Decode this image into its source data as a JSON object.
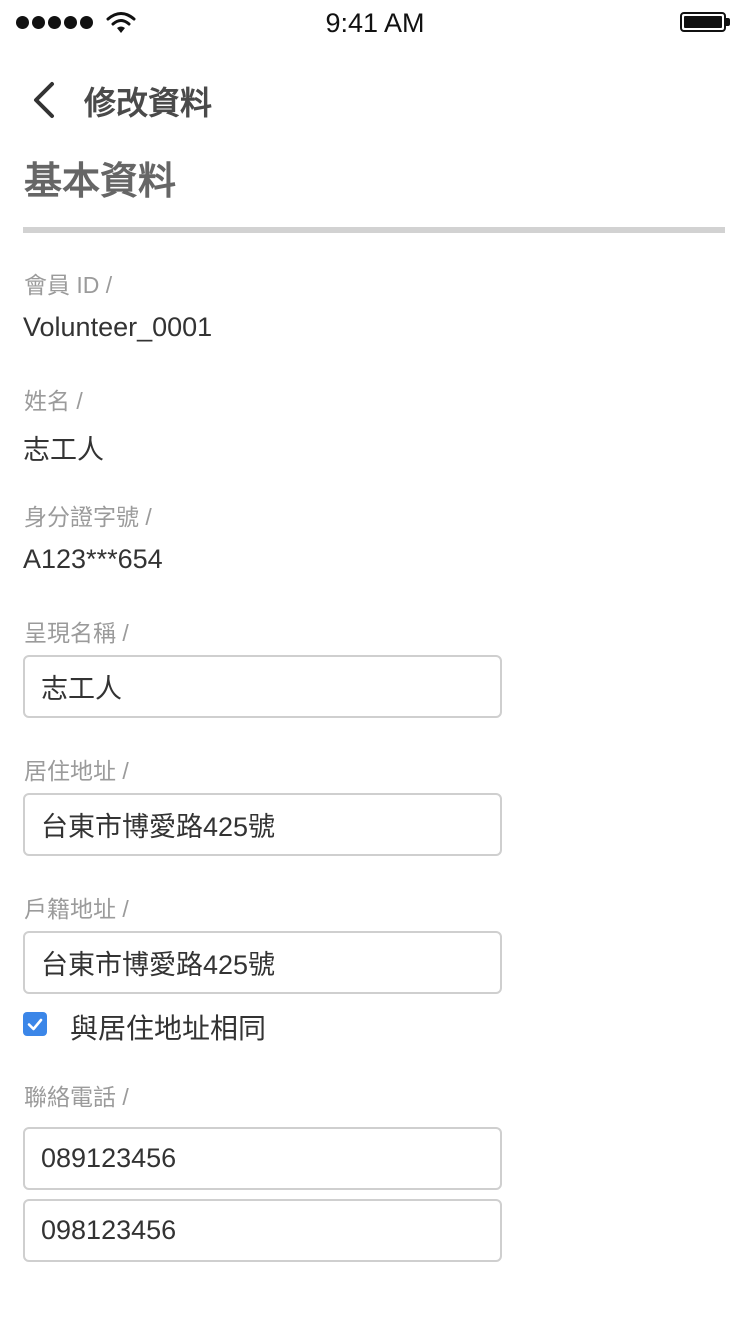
{
  "statusbar": {
    "time": "9:41 AM",
    "signal_icon": "signal-dots-icon",
    "wifi_icon": "wifi-icon",
    "battery_icon": "battery-icon"
  },
  "nav": {
    "back_icon": "chevron-left-icon",
    "title": "修改資料"
  },
  "section_title": "基本資料",
  "fields": {
    "member_id": {
      "label": "會員 ID /",
      "value": "Volunteer_0001"
    },
    "name": {
      "label": "姓名 /",
      "value": "志工人"
    },
    "id_number": {
      "label": "身分證字號 /",
      "value": "A123***654"
    },
    "display_name": {
      "label": "呈現名稱 /",
      "value": "志工人"
    },
    "residence_address": {
      "label": "居住地址 /",
      "value": "台東市博愛路425號"
    },
    "household_address": {
      "label": "戶籍地址 /",
      "value": "台東市博愛路425號"
    },
    "same_address": {
      "label": "與居住地址相同",
      "checked": true
    },
    "phone": {
      "label": "聯絡電話 /",
      "values": [
        "089123456",
        "098123456"
      ]
    }
  },
  "colors": {
    "accent": "#3b86e8",
    "label": "#9b9b9b",
    "text": "#333333",
    "title": "#666666",
    "border": "#cfcfcf"
  }
}
